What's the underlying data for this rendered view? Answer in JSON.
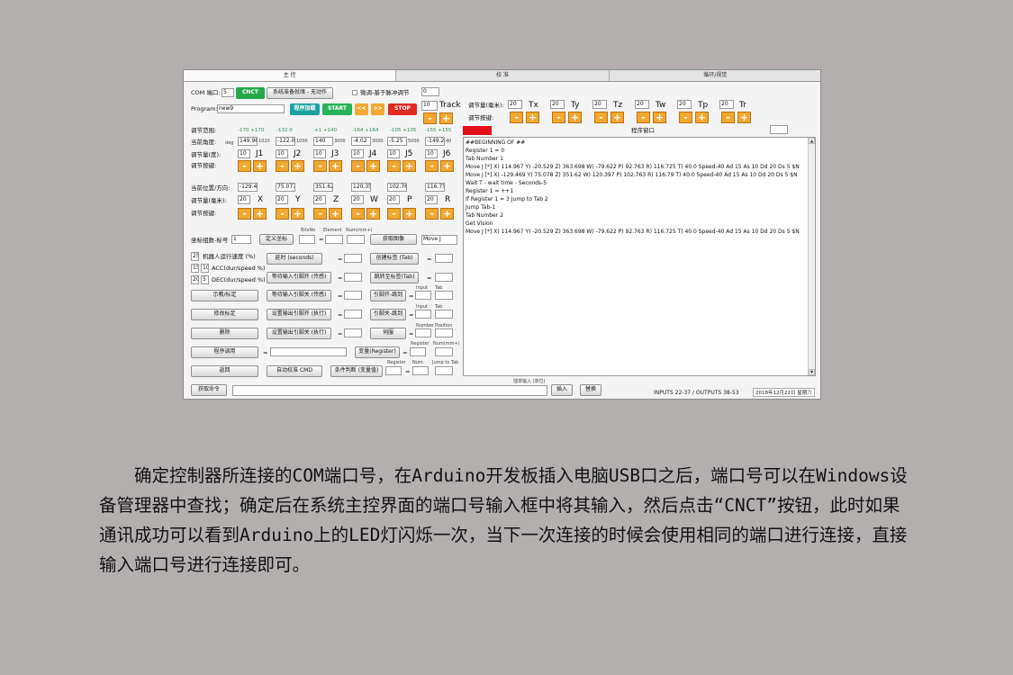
{
  "tabs": [
    "主 控",
    "校 准",
    "循环/视觉"
  ],
  "com": {
    "label": "COM 端口:",
    "value": "5",
    "cnct_label": "CNCT",
    "status_label": "系统准备就绪 - 无动作"
  },
  "smooth": {
    "label": "微调-基于脉冲调节",
    "value": "0"
  },
  "track": {
    "value": "10",
    "label": "Track"
  },
  "program": {
    "label": "Program:",
    "value": "new9"
  },
  "buttons": {
    "save_program": "程序加载",
    "start": "START",
    "prev": "<<",
    "next": ">>",
    "stop": "STOP",
    "minus": "-",
    "plus": "+"
  },
  "joint_panel": {
    "range_label": "调节范围:",
    "ranges": [
      "-170 +170",
      "-132 0",
      "+1 +140",
      "-164 +164",
      "-105 +105",
      "-155 +155"
    ],
    "angle_label": "当前角度:",
    "angle_unit": "deg",
    "angles": [
      "149.98",
      "-122.0",
      "140",
      "-4.02",
      "-5.25",
      "-149.2"
    ],
    "angle_extras": [
      "1020",
      "1000",
      "3000",
      "3000",
      "5000",
      "40"
    ],
    "step_label": "调节量(度):",
    "steps": [
      "10",
      "10",
      "10",
      "10",
      "10",
      "10"
    ],
    "joint_names": [
      "J1",
      "J2",
      "J3",
      "J4",
      "J5",
      "J6"
    ],
    "adjust_label": "调节按键:"
  },
  "cart_panel": {
    "pos_label": "当前位置/方向:",
    "positions": [
      "-129.4",
      "75.077",
      "351.62",
      "120.35",
      "102.76",
      "116.75"
    ],
    "step_label": "调节量(毫米):",
    "steps": [
      "20",
      "20",
      "20",
      "20",
      "20",
      "20"
    ],
    "axes": [
      "X",
      "Y",
      "Z",
      "W",
      "P",
      "R"
    ],
    "adjust_label": "调节按键:"
  },
  "top_right": {
    "step_label": "调节量(毫米):",
    "steps": [
      "20",
      "20",
      "20",
      "20",
      "20",
      "20"
    ],
    "axes": [
      "Tx",
      "Ty",
      "Tz",
      "Tw",
      "Tp",
      "Tr"
    ],
    "adjust_label": "调节按键:",
    "window_label": "程序窗口",
    "window_value": ""
  },
  "coord": {
    "label": "坐标组数-标号",
    "value": "1",
    "define_btn": "定义坐标",
    "small_labels": [
      "BitsNo",
      "Element",
      "Num(mm+)"
    ],
    "eq": "=",
    "get_image": "获取图像",
    "move_j": "Move J"
  },
  "speeds": [
    {
      "a": "25",
      "b": "",
      "text": "机器人运行速度 (%)"
    },
    {
      "a": "15",
      "b": "10",
      "text": "ACC(dur/speed %)"
    },
    {
      "a": "20",
      "b": "5",
      "text": "DEC(dur/speed %)"
    }
  ],
  "left_buttons": [
    "示教/标定",
    "修改标定",
    "删除",
    "程序调用",
    "返回"
  ],
  "mid_buttons": [
    "延时 (seconds)",
    "等待输入引脚开 (传感)",
    "等待输入引脚关 (传感)",
    "设置输出引脚开 (执行)",
    "设置输出引脚关 (执行)",
    "自动校准 CMD"
  ],
  "right_buttons": [
    "创建标签 (Tab)",
    "跳转至标签(Tab)",
    "引脚开-跳到",
    "引脚关-跳到",
    "伺服",
    "变量(Register)",
    "条件判断 (变量值)"
  ],
  "small_labels2": [
    "Input",
    "Tab",
    "Number",
    "Position",
    "Register",
    "Num(mm+)",
    "Num",
    "Jump to Tab"
  ],
  "code_lines": [
    "##BEGINNING OF ##",
    "Register 1 = 0",
    "Tab Number 1",
    "Move J [*]  X) 114.967   Y) -20.529   Z) 363.698   W) -79.622   P) 92.763   R) 116.725   T) 40.0   Speed-40 Ad 15 As 10 Dd 20 Ds 5 $N",
    "Move J [*]  X) -129.469   Y) 75.078   Z) 351.62   W) 120.397   P) 102.763   R) 116.79   T) 40.0   Speed-40 Ad 15 As 10 Dd 20 Ds 5 $N",
    "Wait T - wait time - Seconds-5",
    "Register 1 = ++1",
    "If Register 1 = 3 Jump to Tab 2",
    "Jump Tab-1",
    "Tab Number 2",
    "Get Vision",
    "Move J [*]  X) 114.967   Y) -20.529   Z) 363.698   W) -79.622   P) 92.763   R) 116.725   T) 40.0   Speed-40 Ad 15 As 10 Dd 20 Ds 5 $N"
  ],
  "bottom": {
    "get_cmd": "获取命令",
    "cmd_value": "",
    "small_label": "插单输入 (单位)",
    "insert": "插入",
    "replace": "替换",
    "io": "INPUTS 22-37  /  OUTPUTS 38-53",
    "date": "2018年12月22日 星期六"
  },
  "caption": "确定控制器所连接的COM端口号，在Arduino开发板插入电脑USB口之后，端口号可以在Windows设备管理器中查找；确定后在系统主控界面的端口号输入框中将其输入，然后点击“CNCT”按钮，此时如果通讯成功可以看到Arduino上的LED灯闪烁一次，当下一次连接的时候会使用相同的端口进行连接，直接输入端口号进行连接即可。"
}
